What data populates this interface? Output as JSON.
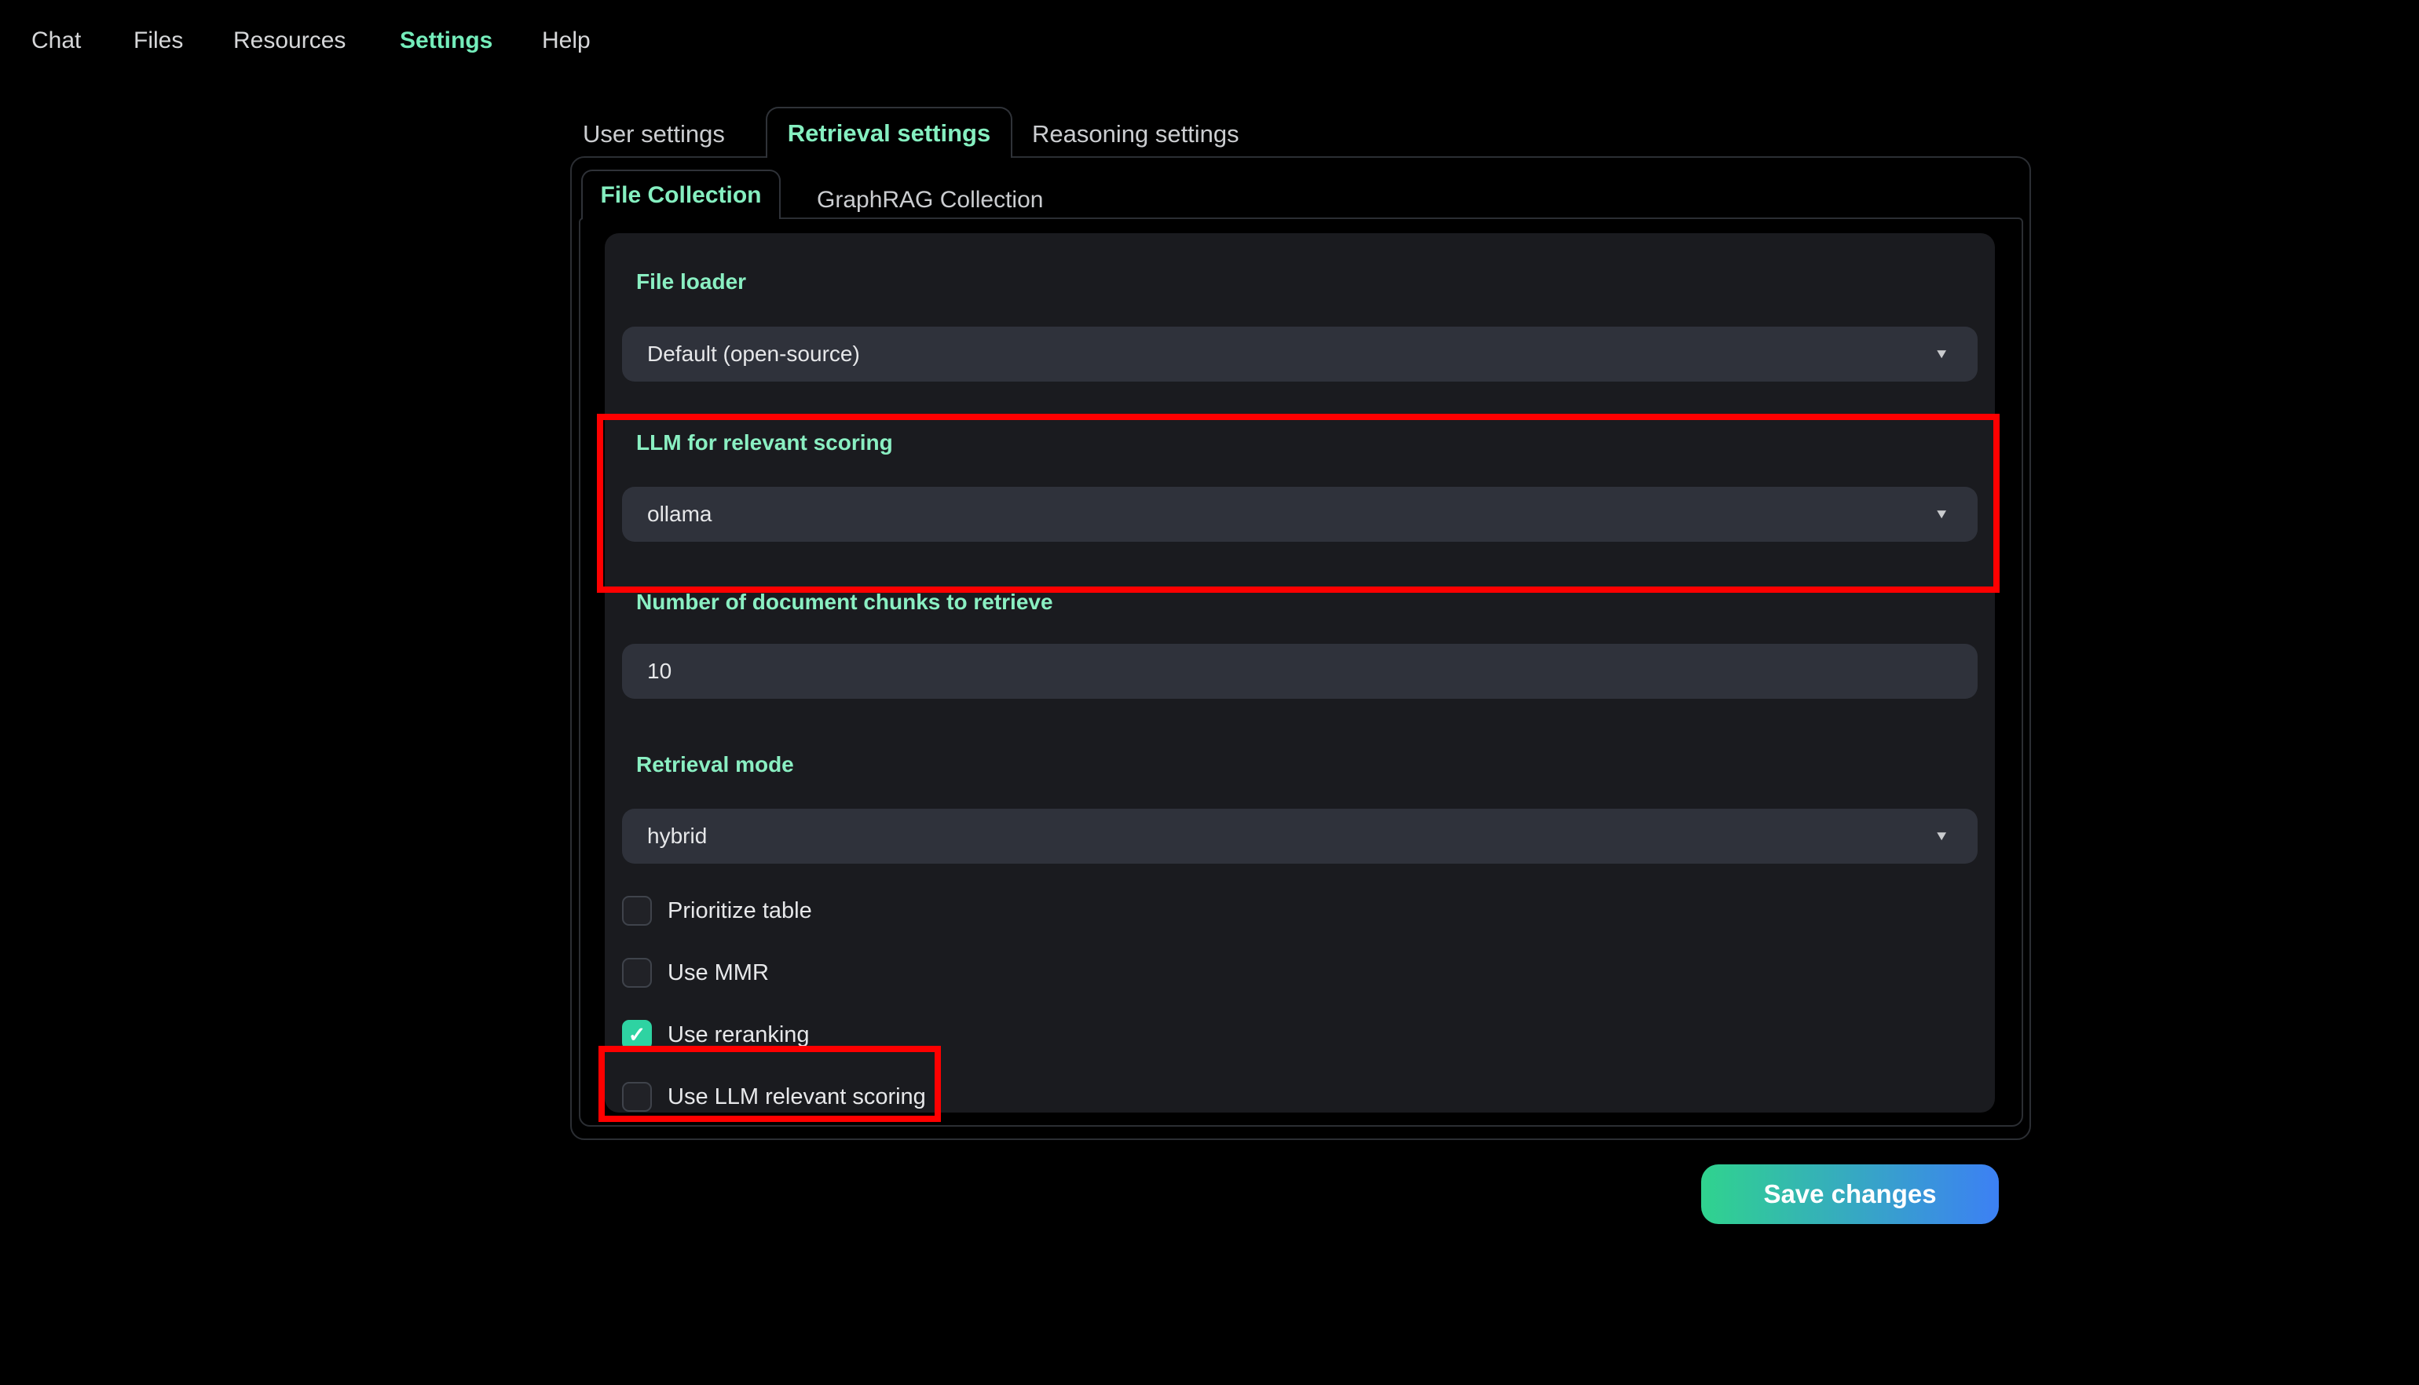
{
  "nav": {
    "items": [
      "Chat",
      "Files",
      "Resources",
      "Settings",
      "Help"
    ],
    "active": "Settings"
  },
  "settings_tabs": {
    "items": [
      "User settings",
      "Retrieval settings",
      "Reasoning settings"
    ],
    "active": "Retrieval settings"
  },
  "collection_tabs": {
    "items": [
      "File Collection",
      "GraphRAG Collection"
    ],
    "active": "File Collection"
  },
  "form": {
    "file_loader": {
      "label": "File loader",
      "value": "Default (open-source)"
    },
    "llm_scoring": {
      "label": "LLM for relevant scoring",
      "value": "ollama"
    },
    "num_chunks": {
      "label": "Number of document chunks to retrieve",
      "value": "10"
    },
    "retrieval_mode": {
      "label": "Retrieval mode",
      "value": "hybrid"
    },
    "checkboxes": [
      {
        "label": "Prioritize table",
        "checked": false
      },
      {
        "label": "Use MMR",
        "checked": false
      },
      {
        "label": "Use reranking",
        "checked": true
      },
      {
        "label": "Use LLM relevant scoring",
        "checked": false
      }
    ]
  },
  "actions": {
    "save_label": "Save changes"
  },
  "icons": {
    "dropdown_caret": "▼",
    "check": "✓"
  },
  "annotations": {
    "highlight_color": "#fe0000",
    "highlighted": [
      "LLM for relevant scoring section",
      "Use LLM relevant scoring checkbox"
    ]
  },
  "colors": {
    "accent_mint": "#85efc0",
    "checkbox_checked": "#2ed3a2",
    "card_bg": "#1a1b1f",
    "field_bg": "#2f323b",
    "button_gradient_start": "#30d38e",
    "button_gradient_end": "#3c80f4"
  }
}
